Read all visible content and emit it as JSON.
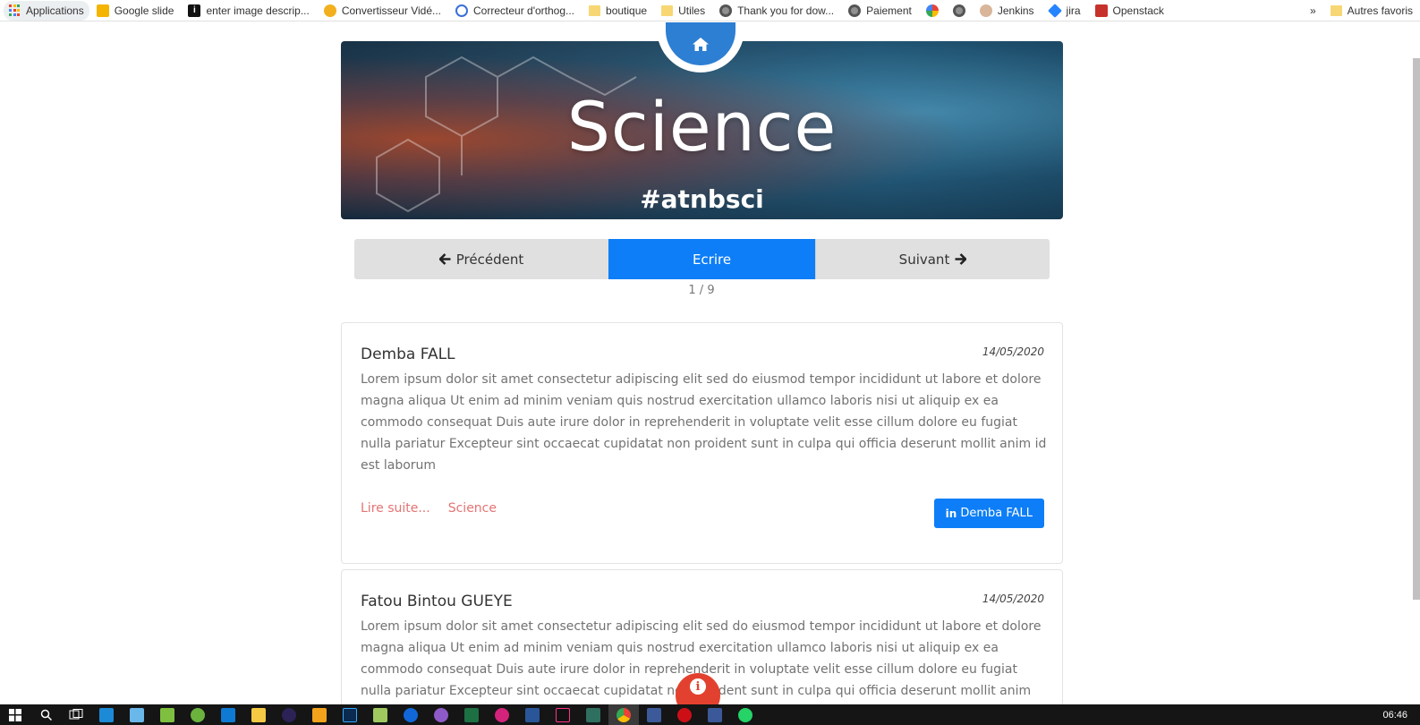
{
  "bookmarks": [
    {
      "label": "Applications",
      "icon": "apps-grid-icon"
    },
    {
      "label": "Google slide",
      "icon": "google-slides-icon"
    },
    {
      "label": "enter image descrip...",
      "icon": "info-page-icon"
    },
    {
      "label": "Convertisseur Vidé...",
      "icon": "converter-icon"
    },
    {
      "label": "Correcteur d'orthog...",
      "icon": "spellcheck-icon"
    },
    {
      "label": "boutique",
      "icon": "folder-icon"
    },
    {
      "label": "Utiles",
      "icon": "folder-icon"
    },
    {
      "label": "Thank you for dow...",
      "icon": "globe-icon"
    },
    {
      "label": "Paiement",
      "icon": "globe-icon"
    },
    {
      "label": "",
      "icon": "pinwheel-icon"
    },
    {
      "label": "",
      "icon": "globe-icon"
    },
    {
      "label": "Jenkins",
      "icon": "jenkins-icon"
    },
    {
      "label": "jira",
      "icon": "jira-icon"
    },
    {
      "label": "Openstack",
      "icon": "openstack-icon"
    }
  ],
  "bookmarks_overflow": "»",
  "bookmarks_other": "Autres favoris",
  "hero": {
    "title": "Science",
    "hashtag": "#atnbsci"
  },
  "nav": {
    "previous": "Précédent",
    "write": "Ecrire",
    "next": "Suivant",
    "pager": "1 / 9"
  },
  "posts": [
    {
      "author": "Demba FALL",
      "date": "14/05/2020",
      "body": "Lorem ipsum dolor sit amet consectetur adipiscing elit sed do eiusmod tempor incididunt ut labore et dolore magna aliqua Ut enim ad minim veniam quis nostrud exercitation ullamco laboris nisi ut aliquip ex ea commodo consequat Duis aute irure dolor in reprehenderit in voluptate velit esse cillum dolore eu fugiat nulla pariatur Excepteur sint occaecat cupidatat non proident sunt in culpa qui officia deserunt mollit anim id est laborum",
      "read_more": "Lire suite...",
      "category": "Science",
      "author_button": "Demba FALL"
    },
    {
      "author": "Fatou Bintou GUEYE",
      "date": "14/05/2020",
      "body": "Lorem ipsum dolor sit amet consectetur adipiscing elit sed do eiusmod tempor incididunt ut labore et dolore magna aliqua Ut enim ad minim veniam quis nostrud exercitation ullamco laboris nisi ut aliquip ex ea commodo consequat Duis aute irure dolor in reprehenderit in voluptate velit esse cillum dolore eu fugiat nulla pariatur Excepteur sint occaecat cupidatat non proident sunt in culpa qui officia deserunt mollit anim"
    }
  ],
  "colors": {
    "accent": "#0d7ef7",
    "link": "#e57373",
    "fab": "#e3412f",
    "home_badge": "#2d7fd3"
  },
  "taskbar": {
    "clock": "06:46",
    "apps": [
      "start-icon",
      "search-icon",
      "task-view-icon",
      "store-icon",
      "explorer-icon",
      "app-icon",
      "spring-icon",
      "vscode-icon",
      "folder-icon",
      "eclipse-icon",
      "notes-icon",
      "photoshop-icon",
      "notepad-icon",
      "browser-icon",
      "github-icon",
      "excel-icon",
      "app-icon",
      "word-icon",
      "intellij-icon",
      "terminal-icon",
      "chrome-icon",
      "security-icon",
      "opera-icon",
      "facebook-icon",
      "whatsapp-icon"
    ]
  }
}
